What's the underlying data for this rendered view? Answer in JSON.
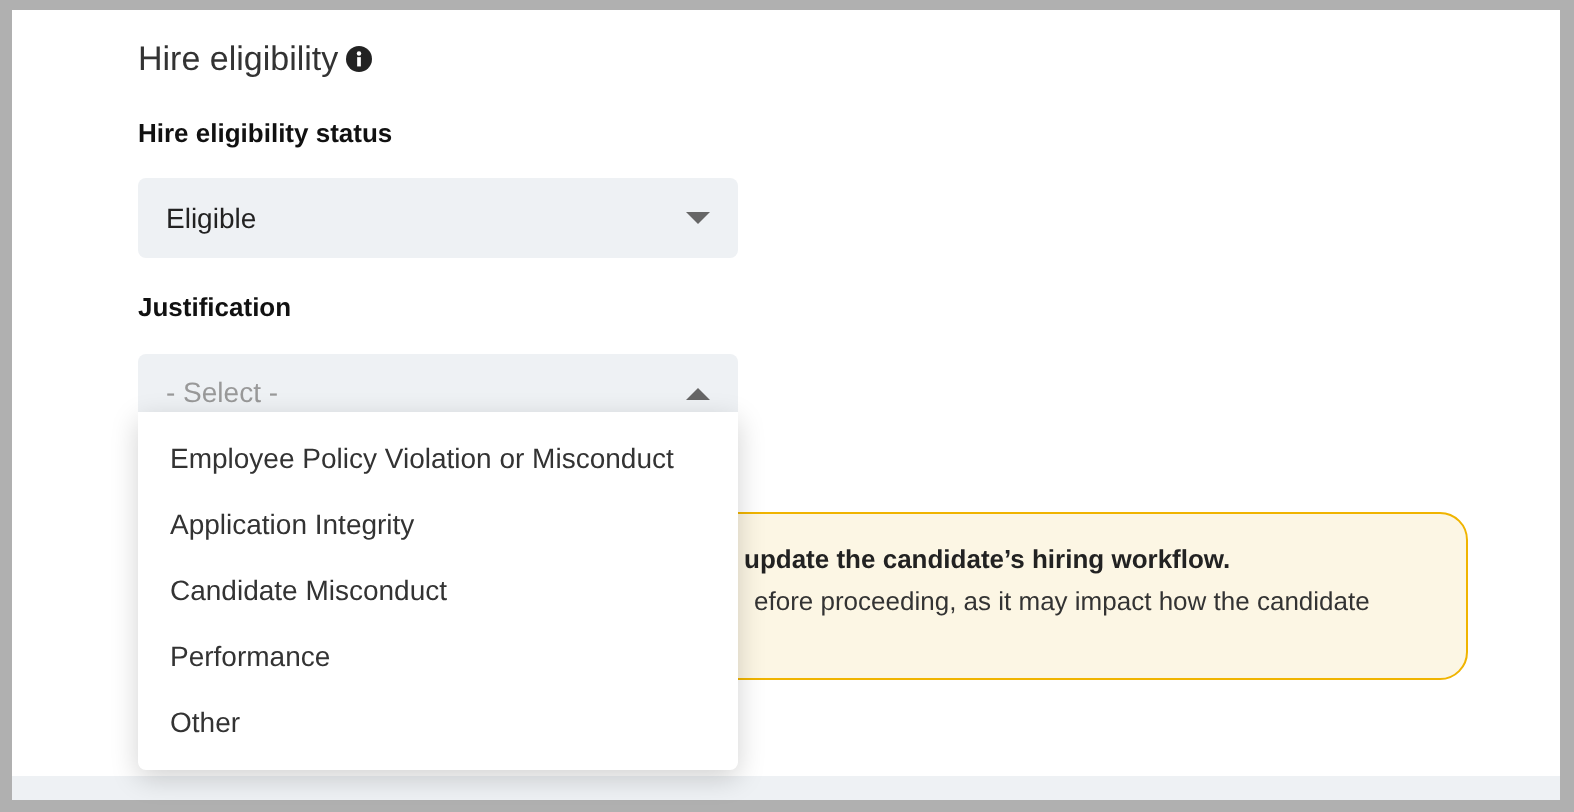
{
  "section": {
    "title": "Hire eligibility"
  },
  "fields": [
    {
      "label": "Hire eligibility status",
      "value": "Eligible",
      "expanded": false
    },
    {
      "label": "Justification",
      "placeholder": "- Select -",
      "expanded": true
    }
  ],
  "dropdown_options": [
    {
      "label": "Employee Policy Violation or Misconduct",
      "selected": false
    },
    {
      "label": "Application Integrity",
      "selected": false
    },
    {
      "label": "Candidate Misconduct",
      "selected": false
    },
    {
      "label": "Performance",
      "selected": false
    },
    {
      "label": "Other",
      "selected": false
    }
  ],
  "warning": {
    "title": "update the candidate’s hiring workflow.",
    "body": "efore proceeding, as it may impact how the candidate"
  }
}
